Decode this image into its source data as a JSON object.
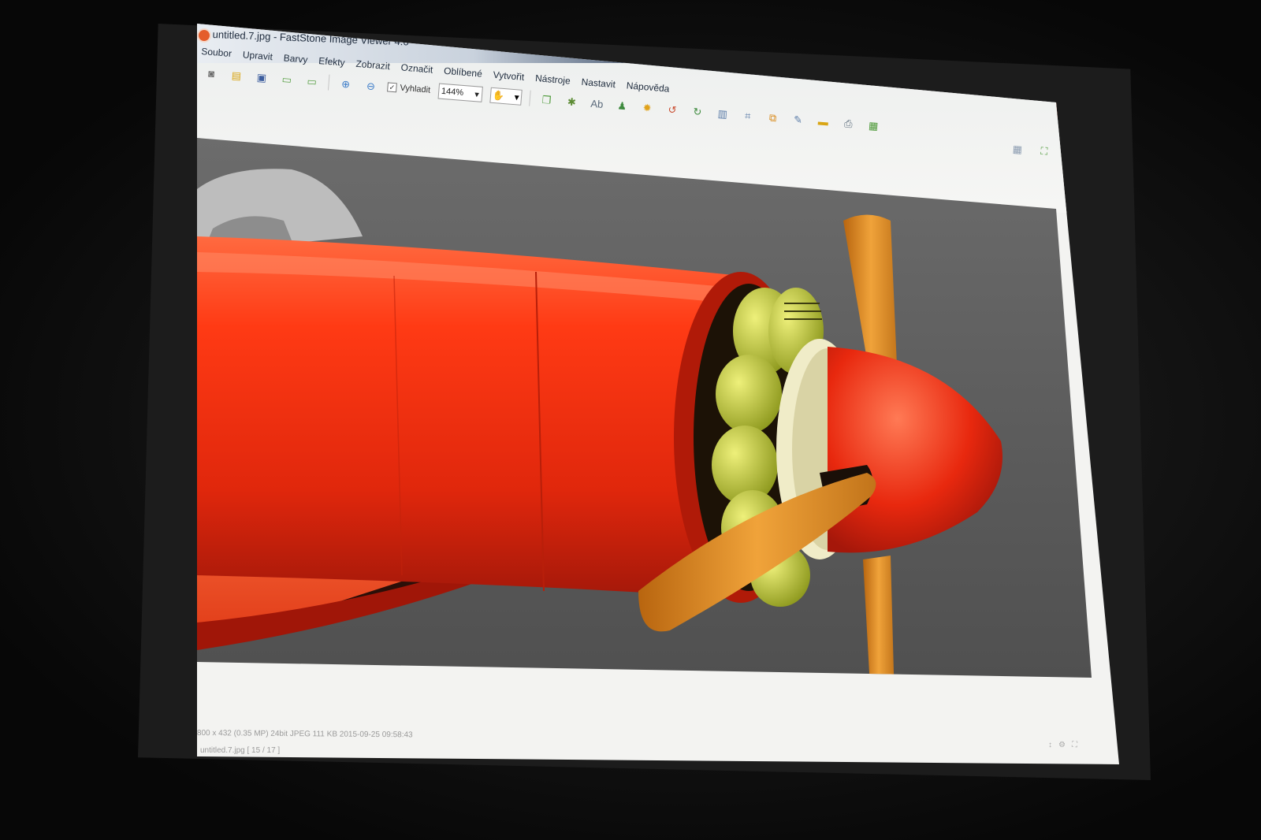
{
  "window": {
    "title": "untitled.7.jpg - FastStone Image Viewer 4.6",
    "controls": {
      "minimize": "–",
      "maximize": "□",
      "close": "✕"
    }
  },
  "menu": [
    "Soubor",
    "Upravit",
    "Barvy",
    "Efekty",
    "Zobrazit",
    "Označit",
    "Oblíbené",
    "Vytvořit",
    "Nástroje",
    "Nastavit",
    "Nápověda"
  ],
  "toolbar": {
    "smooth_label": "Vyhladit",
    "smooth_checked": "✓",
    "zoom_value": "144%",
    "dropdown_arrow": "▾",
    "hand_icon_glyph": "✋",
    "icons": [
      {
        "name": "camera-icon",
        "glyph": "◙",
        "color": "#6b6b6b"
      },
      {
        "name": "open-folder-icon",
        "glyph": "▤",
        "color": "#d9a514"
      },
      {
        "name": "save-icon",
        "glyph": "▣",
        "color": "#3c5d9e"
      },
      {
        "name": "prev-image-icon",
        "glyph": "▭",
        "color": "#4e9a3a"
      },
      {
        "name": "next-image-icon",
        "glyph": "▭",
        "color": "#4e9a3a"
      },
      {
        "name": "zoom-in-icon",
        "glyph": "⊕",
        "color": "#3b7cc9"
      },
      {
        "name": "zoom-out-icon",
        "glyph": "⊖",
        "color": "#3b7cc9"
      }
    ],
    "icons2": [
      {
        "name": "copy-icon",
        "glyph": "❐",
        "color": "#4e9a3a"
      },
      {
        "name": "effects-icon",
        "glyph": "✱",
        "color": "#5b8b33"
      },
      {
        "name": "text-icon",
        "glyph": "Ab",
        "color": "#5a6a7a"
      },
      {
        "name": "user-icon",
        "glyph": "♟",
        "color": "#3d8a3d"
      },
      {
        "name": "sun-icon",
        "glyph": "✹",
        "color": "#e0a21a"
      },
      {
        "name": "rotate-left-icon",
        "glyph": "↺",
        "color": "#c94a2d"
      },
      {
        "name": "rotate-right-icon",
        "glyph": "↻",
        "color": "#3d8a3d"
      },
      {
        "name": "histogram-icon",
        "glyph": "▥",
        "color": "#5b7ca8"
      },
      {
        "name": "crop-icon",
        "glyph": "⌗",
        "color": "#5b7ca8"
      },
      {
        "name": "resize-icon",
        "glyph": "⧉",
        "color": "#d98a1a"
      },
      {
        "name": "draw-icon",
        "glyph": "✎",
        "color": "#5b7ca8"
      },
      {
        "name": "folder-icon",
        "glyph": "▬",
        "color": "#d9a514"
      },
      {
        "name": "print-icon",
        "glyph": "⎙",
        "color": "#5b6b7b"
      },
      {
        "name": "slideshow-icon",
        "glyph": "▦",
        "color": "#4e9a3a"
      }
    ],
    "right_icons": [
      {
        "name": "thumbnails-icon",
        "glyph": "▦",
        "color": "#8a9bb0"
      },
      {
        "name": "fullscreen-icon",
        "glyph": "⛶",
        "color": "#4e9a3a"
      }
    ]
  },
  "status": {
    "info": "800 x 432 (0.35 MP)  24bit  JPEG   111 KB   2015-09-25 09:58:43",
    "file": "untitled.7.jpg [ 15 / 17 ]",
    "icons": [
      "↕",
      "⚙",
      "⛶"
    ]
  },
  "colors": {
    "fuselage": "#e63312",
    "engine": "#b9c23a",
    "propeller": "#d98a1f",
    "spinner_ring": "#f0ecc8",
    "background": "#5e5e5e"
  }
}
